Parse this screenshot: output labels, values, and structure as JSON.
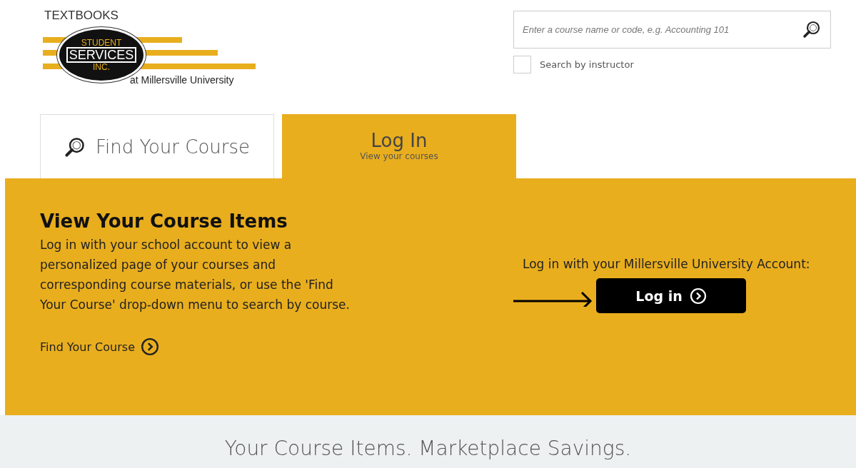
{
  "logo": {
    "top": "TEXTBOOKS",
    "line_1": "STUDENT",
    "line_2": "SERVICES",
    "line_3": "INC.",
    "subtitle": "at Millersville University"
  },
  "search": {
    "placeholder": "Enter a course name or code, e.g. Accounting 101",
    "instructor_option": {
      "label": "Search by instructor",
      "checked": false
    }
  },
  "tabs": [
    {
      "kind": "search",
      "label": "Find Your Course",
      "selected": false
    },
    {
      "kind": "text",
      "label": "Log In",
      "sublabel": "View your courses",
      "selected": true
    }
  ],
  "panel": {
    "heading": "View Your Course Items",
    "body": "Log in with your school account to view a personalized page of your courses and corresponding course materials, or use the 'Find Your Course' drop-down menu to search by course.",
    "link": "Find Your Course",
    "login_prompt": "Log in with your Millersville University Account:",
    "login_button": "Log in"
  },
  "footer": {
    "tagline": "Your Course Items. Marketplace Savings."
  }
}
